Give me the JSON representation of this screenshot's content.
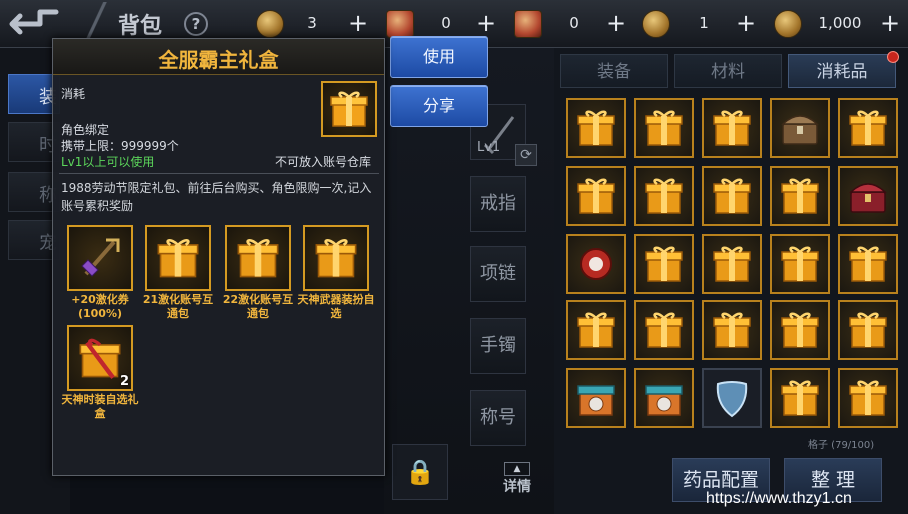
{
  "topbar": {
    "title": "背包",
    "help": "?",
    "resources": [
      {
        "name": "gold-coin",
        "value": "3"
      },
      {
        "name": "scroll",
        "value": "0"
      },
      {
        "name": "scroll-lock",
        "value": "0"
      },
      {
        "name": "bronze-coin",
        "value": "1"
      },
      {
        "name": "silver-coin",
        "value": "1,000"
      }
    ],
    "plus": "+"
  },
  "left_tabs": [
    "装",
    "时",
    "称",
    "宠"
  ],
  "equip_slots": {
    "weapon_level": "Lv1",
    "ring": "戒指",
    "necklace": "项链",
    "bracelet": "手镯",
    "title": "称号"
  },
  "detail_button": "详情",
  "bag_tabs": [
    "装备",
    "材料",
    "消耗品"
  ],
  "capacity": "格子 (79/100)",
  "buttons": {
    "potion_config": "药品配置",
    "sort": "整 理",
    "use": "使用",
    "share": "分享"
  },
  "popup": {
    "title": "全服霸主礼盒",
    "category": "消耗",
    "binding": "角色绑定",
    "carry_limit": "携带上限：999999个",
    "level_req": "Lv1以上可以使用",
    "warehouse": "不可放入账号仓库",
    "description": "1988劳动节限定礼包、前往后台购买、角色限购一次,记入账号累积奖励",
    "rewards": [
      {
        "label": "+20激化券(100%)",
        "icon": "weapon-icon",
        "qty": ""
      },
      {
        "label": "21激化账号互通包",
        "icon": "gift-box-icon",
        "qty": ""
      },
      {
        "label": "22激化账号互通包",
        "icon": "gift-box-icon",
        "qty": ""
      },
      {
        "label": "天神武器装扮自选",
        "icon": "gift-box-icon",
        "qty": ""
      },
      {
        "label": "天神时装自选礼盒",
        "icon": "gift-ribbon-icon",
        "qty": "2"
      }
    ]
  },
  "grid_items": [
    "gift-box",
    "gift-box",
    "gift-box",
    "treasure-chest",
    "gift-box",
    "gift-box",
    "gift-box",
    "gift-box",
    "gift-box",
    "red-chest",
    "red-orb",
    "gift-box",
    "gift-box",
    "gift-box",
    "gift-box",
    "gift-box",
    "gift-box",
    "gift-box",
    "gift-box",
    "gift-box",
    "teal-gift",
    "teal-gift",
    "wing-shield",
    "gift-box",
    "gift-box"
  ],
  "watermark": "https://www.thzy1.cn"
}
